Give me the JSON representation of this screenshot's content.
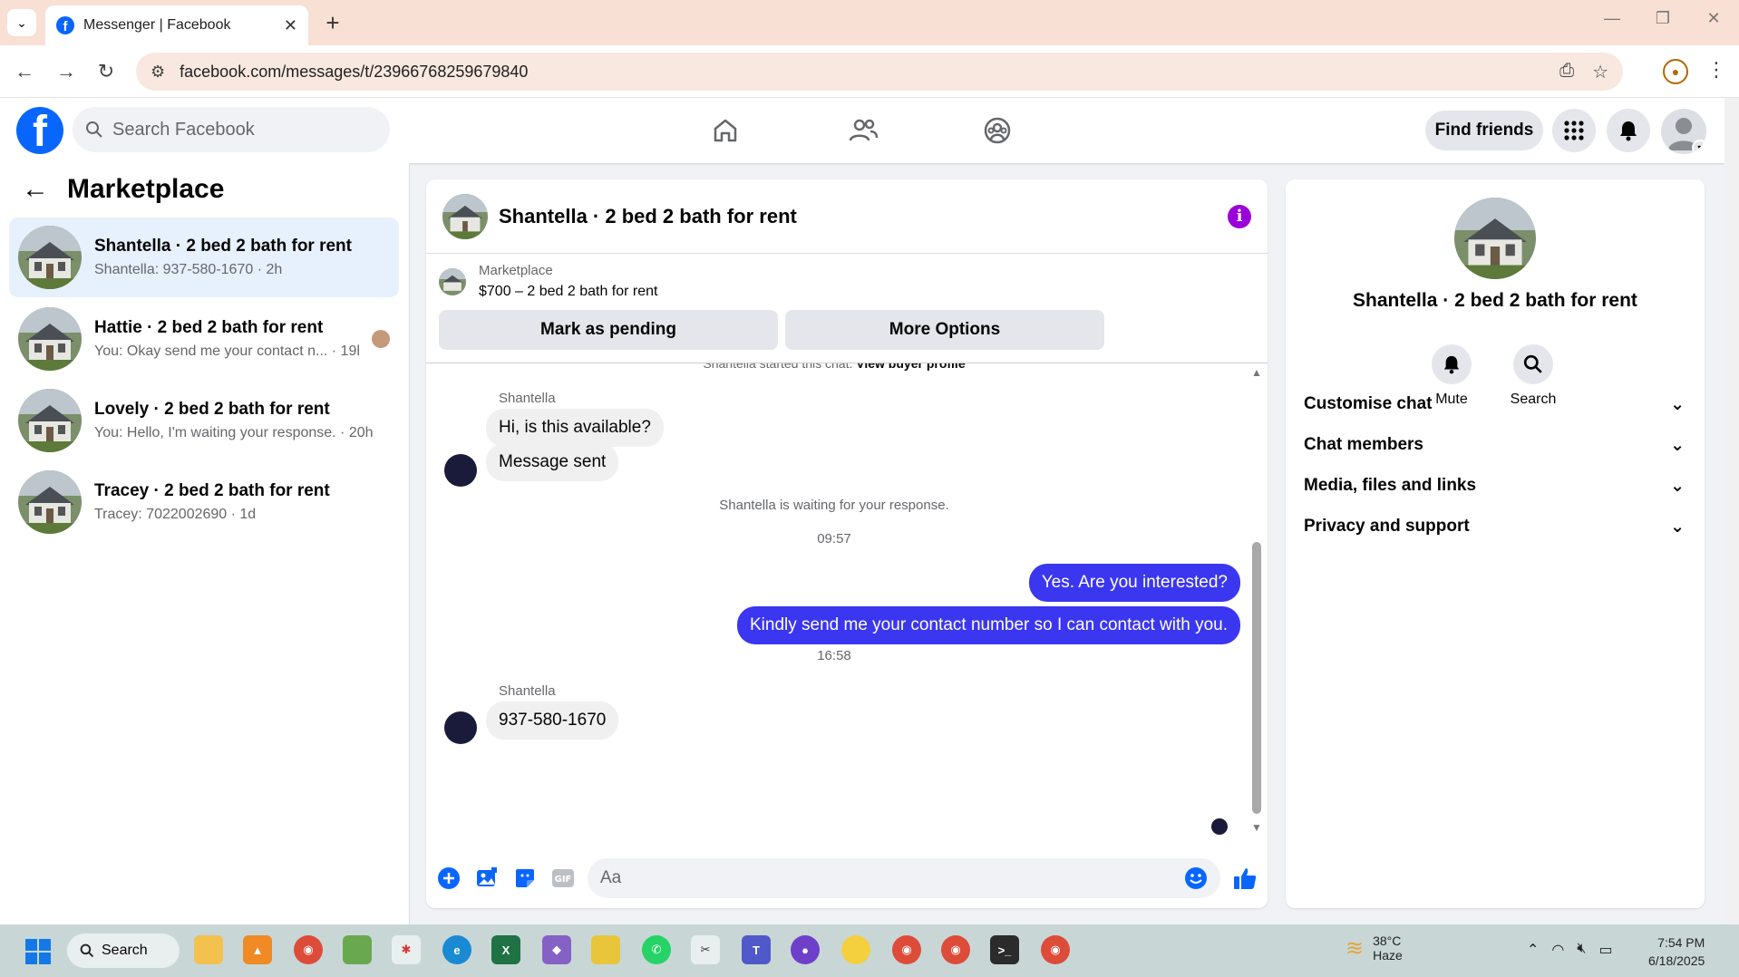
{
  "browser": {
    "tab_title": "Messenger | Facebook",
    "url": "facebook.com/messages/t/23966768259679840"
  },
  "header": {
    "search_placeholder": "Search Facebook",
    "find_friends": "Find friends"
  },
  "left": {
    "title": "Marketplace",
    "conversations": [
      {
        "name": "Shantella · 2 bed 2 bath for rent",
        "preview": "Shantella: 937-580-1670 · 2h",
        "active": true
      },
      {
        "name": "Hattie · 2 bed 2 bath for rent",
        "preview": "You: Okay send me your contact n... · 19h",
        "active": false
      },
      {
        "name": "Lovely · 2 bed 2 bath for rent",
        "preview": "You: Hello, I'm waiting your response. · 20h",
        "active": false
      },
      {
        "name": "Tracey · 2 bed 2 bath for rent",
        "preview": "Tracey: 7022002690 · 1d",
        "active": false
      }
    ]
  },
  "chat": {
    "title": "Shantella · 2 bed 2 bath for rent",
    "marketplace_label": "Marketplace",
    "listing": "$700 – 2 bed 2 bath for rent",
    "mark_pending": "Mark as pending",
    "more_options": "More Options",
    "started_text": "Shantella started this chat.",
    "view_buyer": "View buyer profile",
    "sender1": "Shantella",
    "msg1": "Hi, is this available?",
    "msg2": "Message sent",
    "waiting": "Shantella is waiting for your response.",
    "time1": "09:57",
    "out1": "Yes. Are you interested?",
    "out2": "Kindly send me your contact number so I can contact with you.",
    "time2": "16:58",
    "sender2": "Shantella",
    "msg3": "937-580-1670",
    "composer_placeholder": "Aa"
  },
  "right": {
    "name": "Shantella · 2 bed 2 bath for rent",
    "mute": "Mute",
    "search": "Search",
    "sections": [
      "Customise chat",
      "Chat members",
      "Media, files and links",
      "Privacy and support"
    ]
  },
  "taskbar": {
    "search": "Search",
    "temp": "38°C",
    "weather": "Haze",
    "time": "7:54 PM",
    "date": "6/18/2025"
  },
  "colors": {
    "accent": "#0866ff",
    "outgoing_bubble": "#3b36f0",
    "info_icon": "#9b00d9"
  }
}
